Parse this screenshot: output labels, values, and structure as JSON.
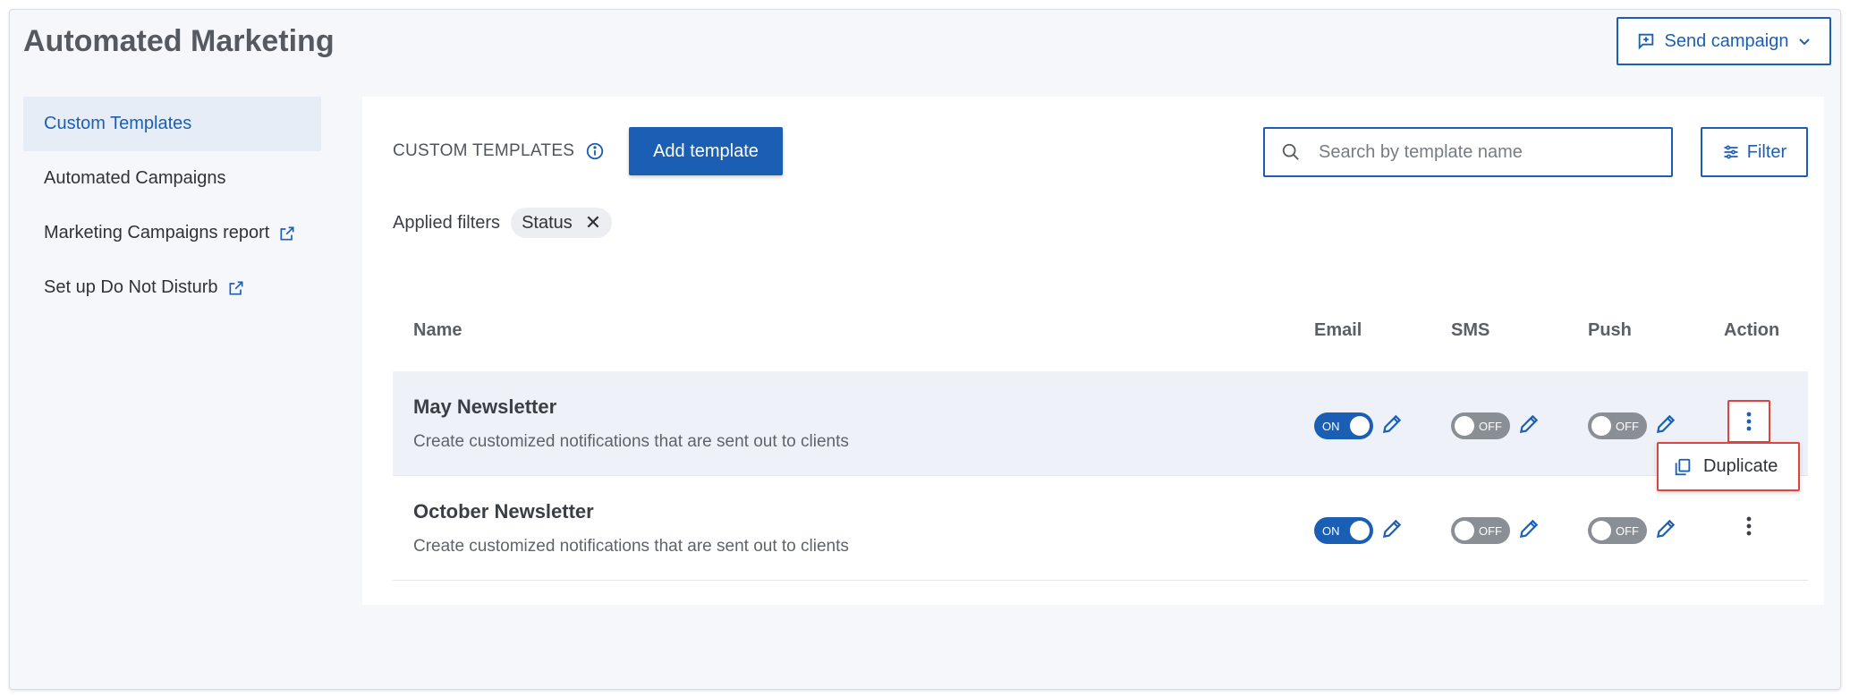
{
  "header": {
    "title": "Automated Marketing",
    "send_campaign_label": "Send campaign"
  },
  "sidebar": {
    "items": [
      {
        "label": "Custom Templates",
        "active": true,
        "external": false
      },
      {
        "label": "Automated Campaigns",
        "active": false,
        "external": false
      },
      {
        "label": "Marketing Campaigns report",
        "active": false,
        "external": true
      },
      {
        "label": "Set up Do Not Disturb",
        "active": false,
        "external": true
      }
    ]
  },
  "main": {
    "section_label": "CUSTOM TEMPLATES",
    "add_template_label": "Add template",
    "search": {
      "placeholder": "Search by template name",
      "value": ""
    },
    "filter_label": "Filter",
    "applied_filters_label": "Applied filters",
    "filters": [
      {
        "label": "Status"
      }
    ],
    "table": {
      "columns": [
        "Name",
        "Email",
        "SMS",
        "Push",
        "Action"
      ],
      "rows": [
        {
          "name": "May Newsletter",
          "description": "Create customized notifications that are sent out to clients",
          "email": "ON",
          "sms": "OFF",
          "push": "OFF"
        },
        {
          "name": "October Newsletter",
          "description": "Create customized notifications that are sent out to clients",
          "email": "ON",
          "sms": "OFF",
          "push": "OFF"
        }
      ]
    },
    "action_menu": {
      "duplicate_label": "Duplicate"
    }
  },
  "colors": {
    "accent": "#1b5fb4",
    "highlight": "#e0443e",
    "toggle_off": "#8a8f96"
  }
}
